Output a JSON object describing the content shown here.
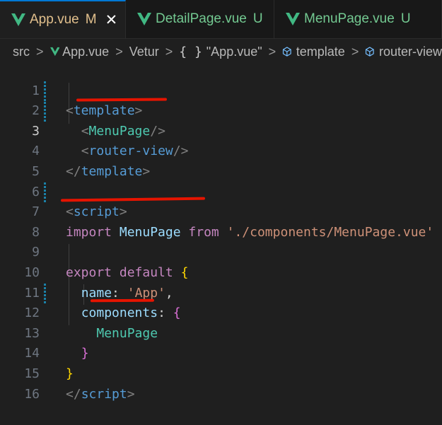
{
  "tabs": [
    {
      "label": "App.vue",
      "status": "M",
      "active": true
    },
    {
      "label": "DetailPage.vue",
      "status": "U",
      "active": false
    },
    {
      "label": "MenuPage.vue",
      "status": "U",
      "active": false
    }
  ],
  "breadcrumb": {
    "src": "src",
    "file": "App.vue",
    "vetur": "Vetur",
    "braces": "{ }",
    "component": "\"App.vue\"",
    "template": "template",
    "router": "router-view"
  },
  "code": {
    "line_numbers": [
      "1",
      "2",
      "3",
      "4",
      "5",
      "6",
      "7",
      "8",
      "9",
      "10",
      "11",
      "12",
      "13",
      "14",
      "15",
      "16"
    ],
    "l1_open": "<",
    "l1_tag": "template",
    "l1_close": ">",
    "l2_open": "<",
    "l2_comp": "MenuPage",
    "l2_close": "/>",
    "l3_open": "<",
    "l3_tag": "router-view",
    "l3_close": "/>",
    "l4_open": "</",
    "l4_tag": "template",
    "l4_close": ">",
    "l6_open": "<",
    "l6_tag": "script",
    "l6_close": ">",
    "l7_import": "import",
    "l7_name": "MenuPage",
    "l7_from": "from",
    "l7_path": "'./components/MenuPage.vue'",
    "l9_export": "export",
    "l9_default": "default",
    "l9_brace": "{",
    "l10_key": "name",
    "l10_colon": ": ",
    "l10_val": "'App'",
    "l10_comma": ",",
    "l11_key": "components",
    "l11_colon": ": ",
    "l11_brace": "{",
    "l12_name": "MenuPage",
    "l13_brace": "}",
    "l14_brace": "}",
    "l15_open": "</",
    "l15_tag": "script",
    "l15_close": ">"
  },
  "colors": {
    "annotation": "#e51400",
    "modified": "#e2c08d",
    "untracked": "#73c991"
  }
}
